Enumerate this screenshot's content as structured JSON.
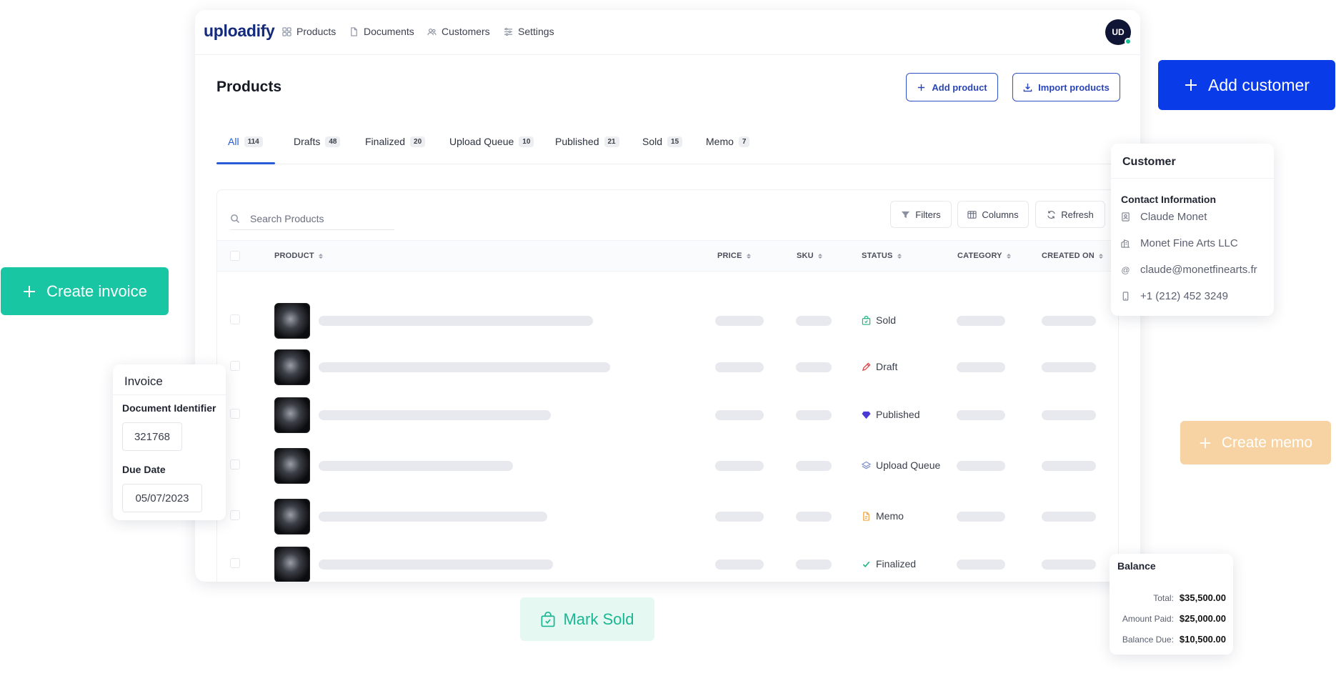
{
  "brand": {
    "logo": "uploadify",
    "avatar_initials": "UD"
  },
  "nav": [
    {
      "label": "Products",
      "icon": "grid-icon"
    },
    {
      "label": "Documents",
      "icon": "document-icon"
    },
    {
      "label": "Customers",
      "icon": "users-icon"
    },
    {
      "label": "Settings",
      "icon": "sliders-icon"
    }
  ],
  "page": {
    "title": "Products",
    "add_product": "Add product",
    "import_products": "Import products"
  },
  "tabs": [
    {
      "label": "All",
      "count": "114",
      "active": true
    },
    {
      "label": "Drafts",
      "count": "48"
    },
    {
      "label": "Finalized",
      "count": "20"
    },
    {
      "label": "Upload Queue",
      "count": "10"
    },
    {
      "label": "Published",
      "count": "21"
    },
    {
      "label": "Sold",
      "count": "15"
    },
    {
      "label": "Memo",
      "count": "7"
    }
  ],
  "toolbar": {
    "search_placeholder": "Search Products",
    "filters": "Filters",
    "columns": "Columns",
    "refresh": "Refresh"
  },
  "table": {
    "headers": [
      "PRODUCT",
      "PRICE",
      "SKU",
      "STATUS",
      "CATEGORY",
      "CREATED ON"
    ],
    "rows": [
      {
        "status": "Sold",
        "status_icon": "bag-check-icon",
        "status_color": "#1fb57f"
      },
      {
        "status": "Draft",
        "status_icon": "pencil-icon",
        "status_color": "#e0474c"
      },
      {
        "status": "Published",
        "status_icon": "diamond-icon",
        "status_color": "#4b3bd6"
      },
      {
        "status": "Upload Queue",
        "status_icon": "layers-icon",
        "status_color": "#7a8fc7"
      },
      {
        "status": "Memo",
        "status_icon": "file-icon",
        "status_color": "#f0a640"
      },
      {
        "status": "Finalized",
        "status_icon": "check-icon",
        "status_color": "#1fb57f"
      }
    ]
  },
  "floating": {
    "add_customer": "Add customer",
    "create_invoice": "Create invoice",
    "create_memo": "Create memo",
    "mark_sold": "Mark Sold"
  },
  "invoice_card": {
    "title": "Invoice",
    "doc_id_label": "Document Identifier",
    "doc_id_value": "321768",
    "due_date_label": "Due Date",
    "due_date_value": "05/07/2023"
  },
  "customer_card": {
    "title": "Customer",
    "section": "Contact Information",
    "name": "Claude Monet",
    "company": "Monet Fine Arts LLC",
    "email": "claude@monetfinearts.fr",
    "phone": "+1 (212) 452 3249"
  },
  "balance_card": {
    "title": "Balance",
    "total_label": "Total:",
    "total_value": "$35,500.00",
    "paid_label": "Amount Paid:",
    "paid_value": "$25,000.00",
    "due_label": "Balance Due:",
    "due_value": "$10,500.00"
  },
  "colors": {
    "primary_blue": "#0a3be8",
    "teal": "#18c6a3",
    "memo_peach": "#f7d3a3",
    "mark_sold_bg": "#e6f8f2",
    "mark_sold_fg": "#1bb793"
  }
}
